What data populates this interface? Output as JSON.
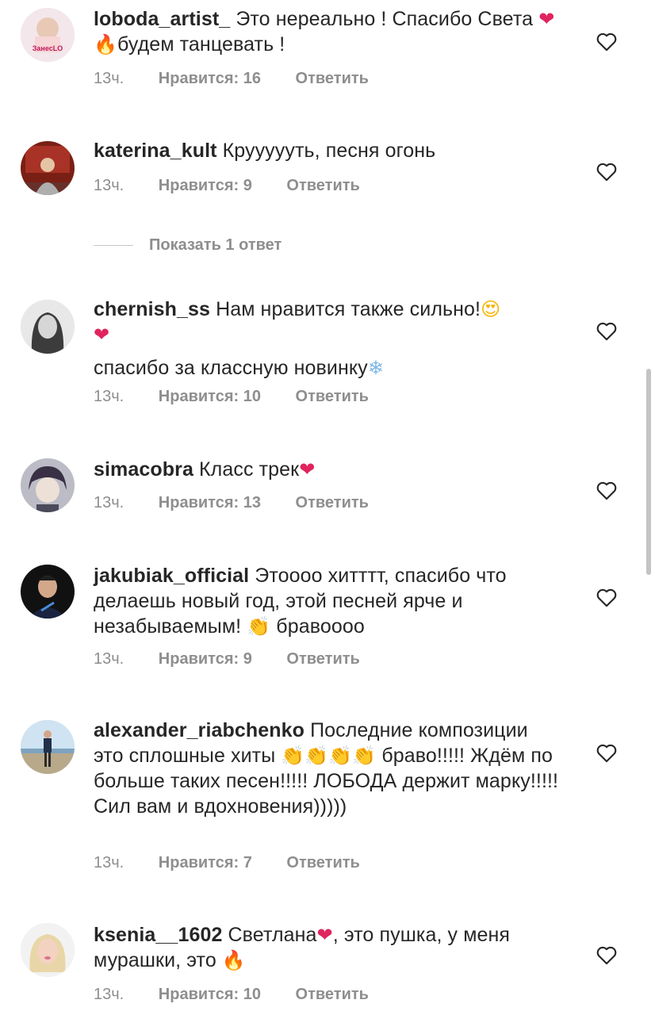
{
  "comments": [
    {
      "username": "loboda_artist_",
      "text_parts": [
        "Это нереально ! Спасибо Света ",
        "❤",
        " ",
        "🔥",
        "будем танцевать !"
      ],
      "time": "13ч.",
      "likes": "Нравится: 16",
      "reply": "Ответить",
      "avatar_label": "ЗанесLO"
    },
    {
      "username": "katerina_kult",
      "text_parts": [
        "Круууууть, песня огонь"
      ],
      "time": "13ч.",
      "likes": "Нравится: 9",
      "reply": "Ответить"
    },
    {
      "username": "chernish_ss",
      "text_parts": [
        "Нам нравится также сильно!",
        "😍",
        "❤",
        "спасибо за классную новинку",
        "❄"
      ],
      "time": "13ч.",
      "likes": "Нравится: 10",
      "reply": "Ответить"
    },
    {
      "username": "simacobra",
      "text_parts": [
        "Класс трек",
        "❤"
      ],
      "time": "13ч.",
      "likes": "Нравится: 13",
      "reply": "Ответить"
    },
    {
      "username": "jakubiak_official",
      "text_parts": [
        "Этоооо хитттт, спасибо что делаешь новый год, этой песней ярче и незабываемым! ",
        "👏",
        " бравоооо"
      ],
      "time": "13ч.",
      "likes": "Нравится: 9",
      "reply": "Ответить"
    },
    {
      "username": "alexander_riabchenko",
      "text_parts": [
        "Последние композиции это сплошные хиты ",
        "👏👏👏👏",
        " браво!!!!! Ждём по больше таких песен!!!!! ЛОБОДА держит марку!!!!! Сил вам и вдохновения)))))"
      ],
      "time": "13ч.",
      "likes": "Нравится: 7",
      "reply": "Ответить"
    },
    {
      "username": "ksenia__1602",
      "text_parts": [
        "Светлана",
        "❤",
        ", это пушка, у меня мурашки, это ",
        "🔥"
      ],
      "time": "13ч.",
      "likes": "Нравится: 10",
      "reply": "Ответить"
    }
  ],
  "view_replies": "Показать 1 ответ",
  "icons": {
    "like": "heart-outline-icon"
  },
  "colors": {
    "text": "#262626",
    "secondary": "#8e8e8e",
    "emoji_heart": "#e0245e",
    "emoji_fire": "#ff7a00"
  }
}
